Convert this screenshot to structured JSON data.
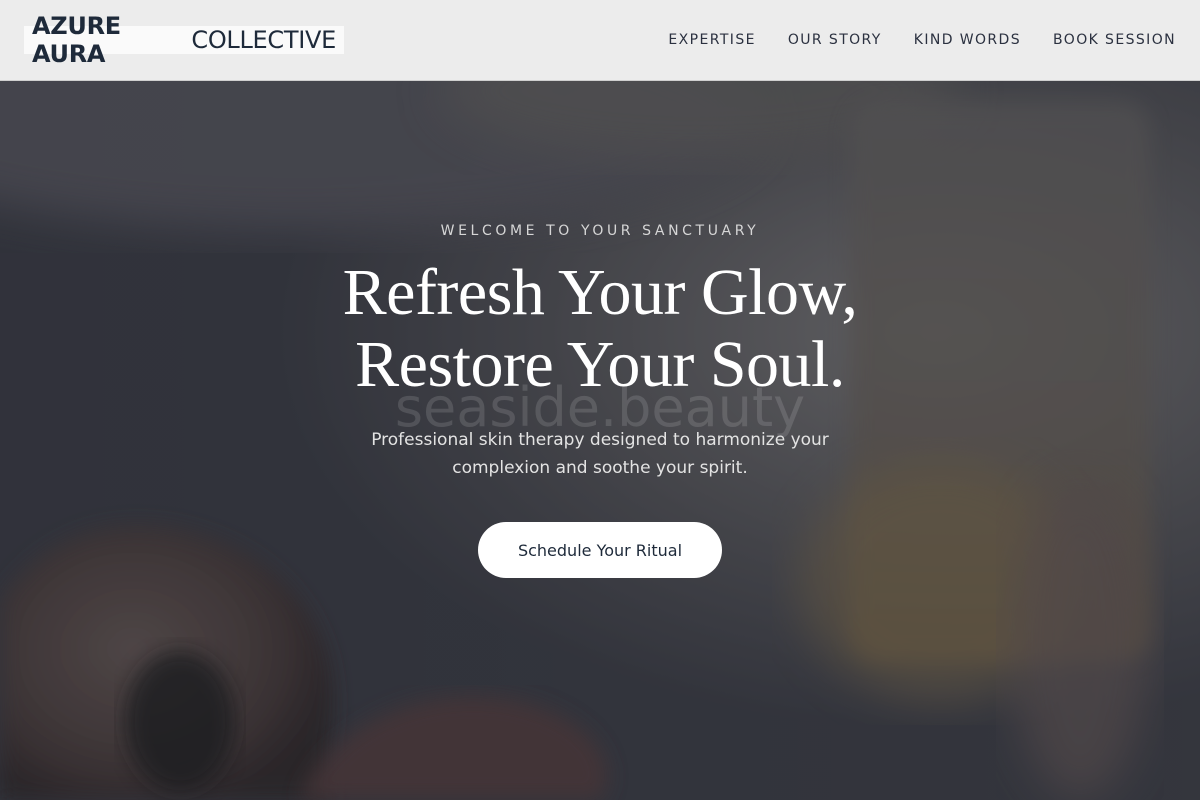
{
  "brand": {
    "bold": "AZURE AURA",
    "light": "COLLECTIVE"
  },
  "nav": {
    "items": [
      {
        "label": "EXPERTISE"
      },
      {
        "label": "OUR STORY"
      },
      {
        "label": "KIND WORDS"
      },
      {
        "label": "BOOK SESSION"
      }
    ]
  },
  "hero": {
    "eyebrow": "WELCOME TO YOUR SANCTUARY",
    "headline_line1": "Refresh Your Glow,",
    "headline_line2": "Restore Your Soul.",
    "watermark": "seaside.beauty",
    "subtext": "Professional skin therapy designed to harmonize your complexion and soothe your spirit.",
    "cta_label": "Schedule Your Ritual"
  },
  "colors": {
    "header_bg": "#ececec",
    "brand_text": "#1e2a3a",
    "cta_bg": "#ffffff"
  }
}
